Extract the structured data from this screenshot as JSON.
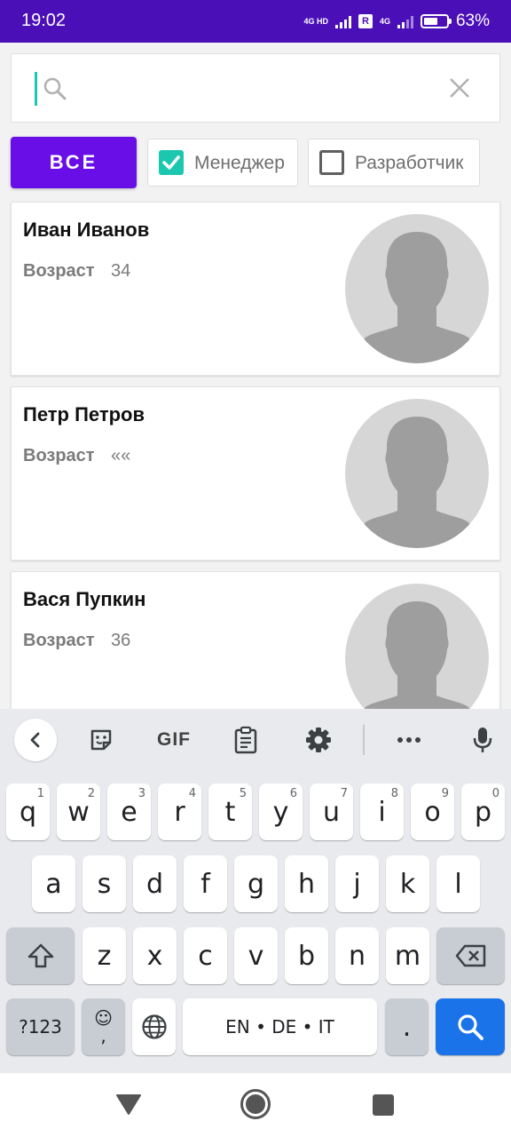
{
  "status": {
    "time": "19:02",
    "network1": "4G HD",
    "roaming": "R",
    "network2": "4G",
    "battery_pct": "63%",
    "battery_level": 0.63
  },
  "search": {
    "value": "",
    "placeholder": ""
  },
  "filters": {
    "all_label": "ВСЕ",
    "items": [
      {
        "label": "Менеджер",
        "checked": true
      },
      {
        "label": "Разработчик",
        "checked": false
      }
    ]
  },
  "people": [
    {
      "name": "Иван Иванов",
      "age_label": "Возраст",
      "age": "34"
    },
    {
      "name": "Петр Петров",
      "age_label": "Возраст",
      "age": "««"
    },
    {
      "name": "Вася Пупкин",
      "age_label": "Возраст",
      "age": "36"
    }
  ],
  "keyboard": {
    "toolbar_icons": [
      "back-icon",
      "sticker-icon",
      "gif-icon",
      "clipboard-icon",
      "settings-icon",
      "more-icon",
      "mic-icon"
    ],
    "gif_label": "GIF",
    "row1": [
      "q",
      "w",
      "e",
      "r",
      "t",
      "y",
      "u",
      "i",
      "o",
      "p"
    ],
    "row1_hints": [
      "1",
      "2",
      "3",
      "4",
      "5",
      "6",
      "7",
      "8",
      "9",
      "0"
    ],
    "row2": [
      "a",
      "s",
      "d",
      "f",
      "g",
      "h",
      "j",
      "k",
      "l"
    ],
    "row3": [
      "z",
      "x",
      "c",
      "v",
      "b",
      "n",
      "m"
    ],
    "symbols_label": "?123",
    "emoji_label": "☺",
    "comma_label": ",",
    "space_label": "EN • DE • IT",
    "period_label": ".",
    "accent_color": "#1a73e8"
  },
  "colors": {
    "status_bar": "#4b0fb8",
    "chip_all": "#6a0ee8",
    "checkbox_checked": "#1cc7b0"
  }
}
